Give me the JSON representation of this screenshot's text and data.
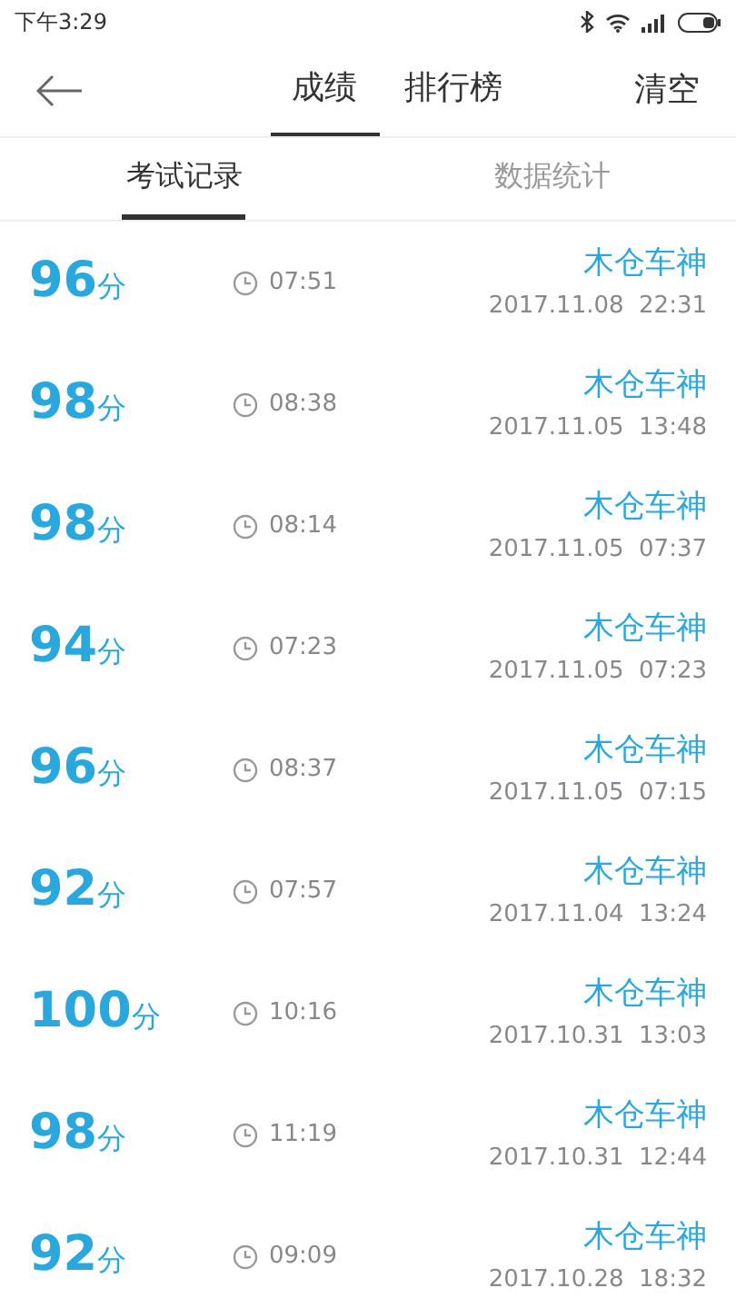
{
  "status_bar": {
    "time": "下午3:29"
  },
  "header": {
    "tabs": [
      {
        "label": "成绩",
        "selected": true
      },
      {
        "label": "排行榜",
        "selected": false
      }
    ],
    "action": "清空"
  },
  "sub_tabs": [
    {
      "label": "考试记录",
      "selected": true
    },
    {
      "label": "数据统计",
      "selected": false
    }
  ],
  "records": [
    {
      "score": "96",
      "unit": "分",
      "duration": "07:51",
      "name": "木仓车神",
      "date": "2017.11.08  22:31"
    },
    {
      "score": "98",
      "unit": "分",
      "duration": "08:38",
      "name": "木仓车神",
      "date": "2017.11.05  13:48"
    },
    {
      "score": "98",
      "unit": "分",
      "duration": "08:14",
      "name": "木仓车神",
      "date": "2017.11.05  07:37"
    },
    {
      "score": "94",
      "unit": "分",
      "duration": "07:23",
      "name": "木仓车神",
      "date": "2017.11.05  07:23"
    },
    {
      "score": "96",
      "unit": "分",
      "duration": "08:37",
      "name": "木仓车神",
      "date": "2017.11.05  07:15"
    },
    {
      "score": "92",
      "unit": "分",
      "duration": "07:57",
      "name": "木仓车神",
      "date": "2017.11.04  13:24"
    },
    {
      "score": "100",
      "unit": "分",
      "duration": "10:16",
      "name": "木仓车神",
      "date": "2017.10.31  13:03"
    },
    {
      "score": "98",
      "unit": "分",
      "duration": "11:19",
      "name": "木仓车神",
      "date": "2017.10.31  12:44"
    },
    {
      "score": "92",
      "unit": "分",
      "duration": "09:09",
      "name": "木仓车神",
      "date": "2017.10.28  18:32"
    }
  ]
}
